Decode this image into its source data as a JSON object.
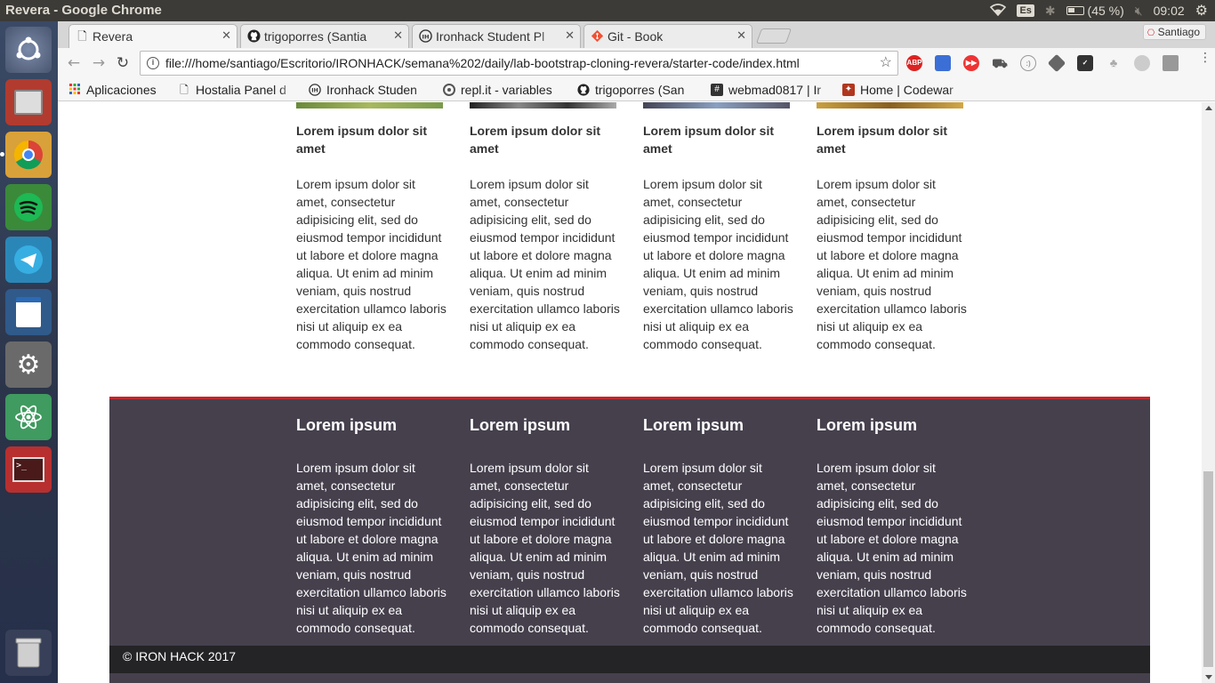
{
  "window": {
    "title": "Revera - Google Chrome"
  },
  "system_tray": {
    "keyboard": "Es",
    "battery": "(45 %)",
    "time": "09:02"
  },
  "tabs": [
    {
      "label": "Revera",
      "icon": "page-icon",
      "active": true
    },
    {
      "label": "trigoporres (Santia",
      "icon": "github-icon"
    },
    {
      "label": "Ironhack Student Pl",
      "icon": "ironhack-icon"
    },
    {
      "label": "Git - Book",
      "icon": "git-icon"
    }
  ],
  "profile": {
    "name": "Santiago"
  },
  "address_bar": {
    "url": "file:///home/santiago/Escritorio/IRONHACK/semana%202/daily/lab-bootstrap-cloning-revera/starter-code/index.html"
  },
  "bookmarks": [
    {
      "label": "Aplicaciones",
      "icon": "apps-grid-icon"
    },
    {
      "label": "Hostalia Panel d",
      "icon": "page-icon"
    },
    {
      "label": "Ironhack Studen",
      "icon": "ironhack-icon"
    },
    {
      "label": "repl.it - variables",
      "icon": "replit-icon"
    },
    {
      "label": "trigoporres (San",
      "icon": "github-icon"
    },
    {
      "label": "webmad0817 | Ir",
      "icon": "slack-icon"
    },
    {
      "label": "Home | Codewar",
      "icon": "codewars-icon"
    }
  ],
  "content": {
    "columns": [
      {
        "title": "Lorem ipsum dolor sit amet",
        "text": "Lorem ipsum dolor sit amet, consectetur adipisicing elit, sed do eiusmod tempor incididunt ut labore et dolore magna aliqua. Ut enim ad minim veniam, quis nostrud exercitation ullamco laboris nisi ut aliquip ex ea commodo consequat."
      },
      {
        "title": "Lorem ipsum dolor sit amet",
        "text": "Lorem ipsum dolor sit amet, consectetur adipisicing elit, sed do eiusmod tempor incididunt ut labore et dolore magna aliqua. Ut enim ad minim veniam, quis nostrud exercitation ullamco laboris nisi ut aliquip ex ea commodo consequat."
      },
      {
        "title": "Lorem ipsum dolor sit amet",
        "text": "Lorem ipsum dolor sit amet, consectetur adipisicing elit, sed do eiusmod tempor incididunt ut labore et dolore magna aliqua. Ut enim ad minim veniam, quis nostrud exercitation ullamco laboris nisi ut aliquip ex ea commodo consequat."
      },
      {
        "title": "Lorem ipsum dolor sit amet",
        "text": "Lorem ipsum dolor sit amet, consectetur adipisicing elit, sed do eiusmod tempor incididunt ut labore et dolore magna aliqua. Ut enim ad minim veniam, quis nostrud exercitation ullamco laboris nisi ut aliquip ex ea commodo consequat."
      }
    ]
  },
  "footer": {
    "columns": [
      {
        "heading": "Lorem ipsum",
        "text": "Lorem ipsum dolor sit amet, consectetur adipisicing elit, sed do eiusmod tempor incididunt ut labore et dolore magna aliqua. Ut enim ad minim veniam, quis nostrud exercitation ullamco laboris nisi ut aliquip ex ea commodo consequat."
      },
      {
        "heading": "Lorem ipsum",
        "text": "Lorem ipsum dolor sit amet, consectetur adipisicing elit, sed do eiusmod tempor incididunt ut labore et dolore magna aliqua. Ut enim ad minim veniam, quis nostrud exercitation ullamco laboris nisi ut aliquip ex ea commodo consequat."
      },
      {
        "heading": "Lorem ipsum",
        "text": "Lorem ipsum dolor sit amet, consectetur adipisicing elit, sed do eiusmod tempor incididunt ut labore et dolore magna aliqua. Ut enim ad minim veniam, quis nostrud exercitation ullamco laboris nisi ut aliquip ex ea commodo consequat."
      },
      {
        "heading": "Lorem ipsum",
        "text": "Lorem ipsum dolor sit amet, consectetur adipisicing elit, sed do eiusmod tempor incididunt ut labore et dolore magna aliqua. Ut enim ad minim veniam, quis nostrud exercitation ullamco laboris nisi ut aliquip ex ea commodo consequat."
      }
    ],
    "copyright": "© IRON HACK 2017"
  },
  "colors": {
    "footer_bg": "#46404d",
    "footer_border": "#c1272d",
    "copyright_bg": "#242326"
  }
}
